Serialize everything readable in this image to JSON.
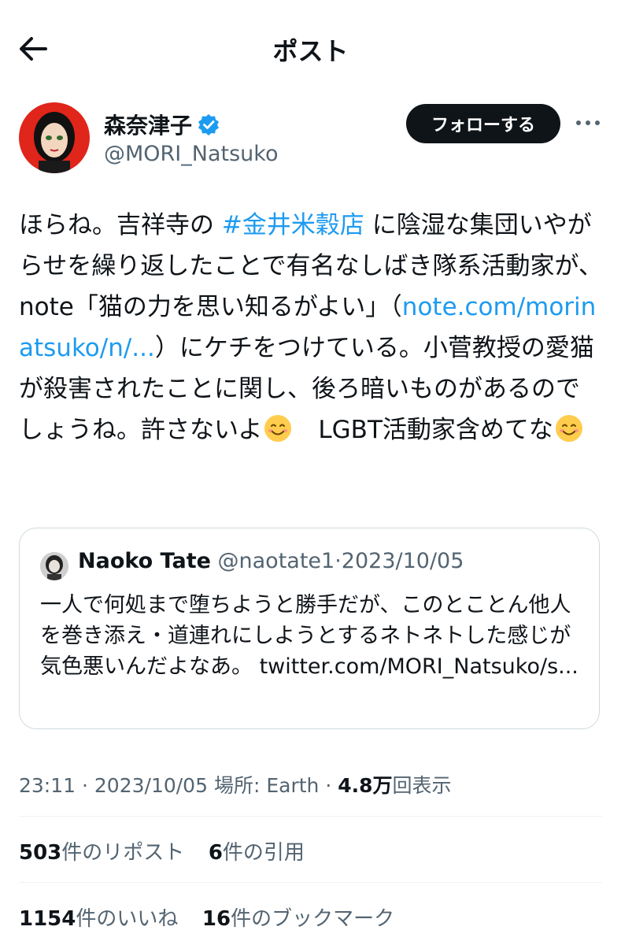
{
  "header": {
    "title": "ポスト"
  },
  "author": {
    "display_name": "森奈津子",
    "handle": "@MORI_Natsuko",
    "follow_label": "フォローする"
  },
  "post": {
    "line1_a": "ほらね。吉祥寺の ",
    "hashtag": "#金井米穀店",
    "line1_b": " に陰湿な集団いやがらせを繰り返したことで有名なしばき隊系活動家が、note「猫の力を思い知るがよい」（",
    "link": "note.com/morinatsuko/n/...",
    "line_c": "）にケチをつけている。小菅教授の愛猫が殺害されたことに関し、後ろ暗いものがあるのでしょうね。許さないよ",
    "line_d": "　LGBT活動家含めてな"
  },
  "quote": {
    "name": "Naoko Tate",
    "handle": "@naotate1",
    "separator": "·",
    "date": "2023/10/05",
    "text": "一人で何処まで堕ちようと勝手だが、このとことん他人を巻き添え・道連れにしようとするネトネトした感じが気色悪いんだよなあ。 twitter.com/MORI_Natsuko/s..."
  },
  "meta": {
    "time": "23:11",
    "sep1": "·",
    "date": "2023/10/05",
    "location": "場所: Earth",
    "sep2": "·",
    "views_num": "4.8万",
    "views_label": "回表示"
  },
  "stats": {
    "reposts_num": "503",
    "reposts_label": "件のリポスト",
    "quotes_num": "6",
    "quotes_label": "件の引用",
    "likes_num": "1154",
    "likes_label": "件のいいね",
    "bookmarks_num": "16",
    "bookmarks_label": "件のブックマーク"
  },
  "colors": {
    "link": "#1d9bf0",
    "secondary": "#536471",
    "follow_bg": "#0f1419"
  },
  "icons": [
    "back-arrow-icon",
    "verified-badge-icon",
    "more-icon",
    "smile-emoji-icon"
  ]
}
